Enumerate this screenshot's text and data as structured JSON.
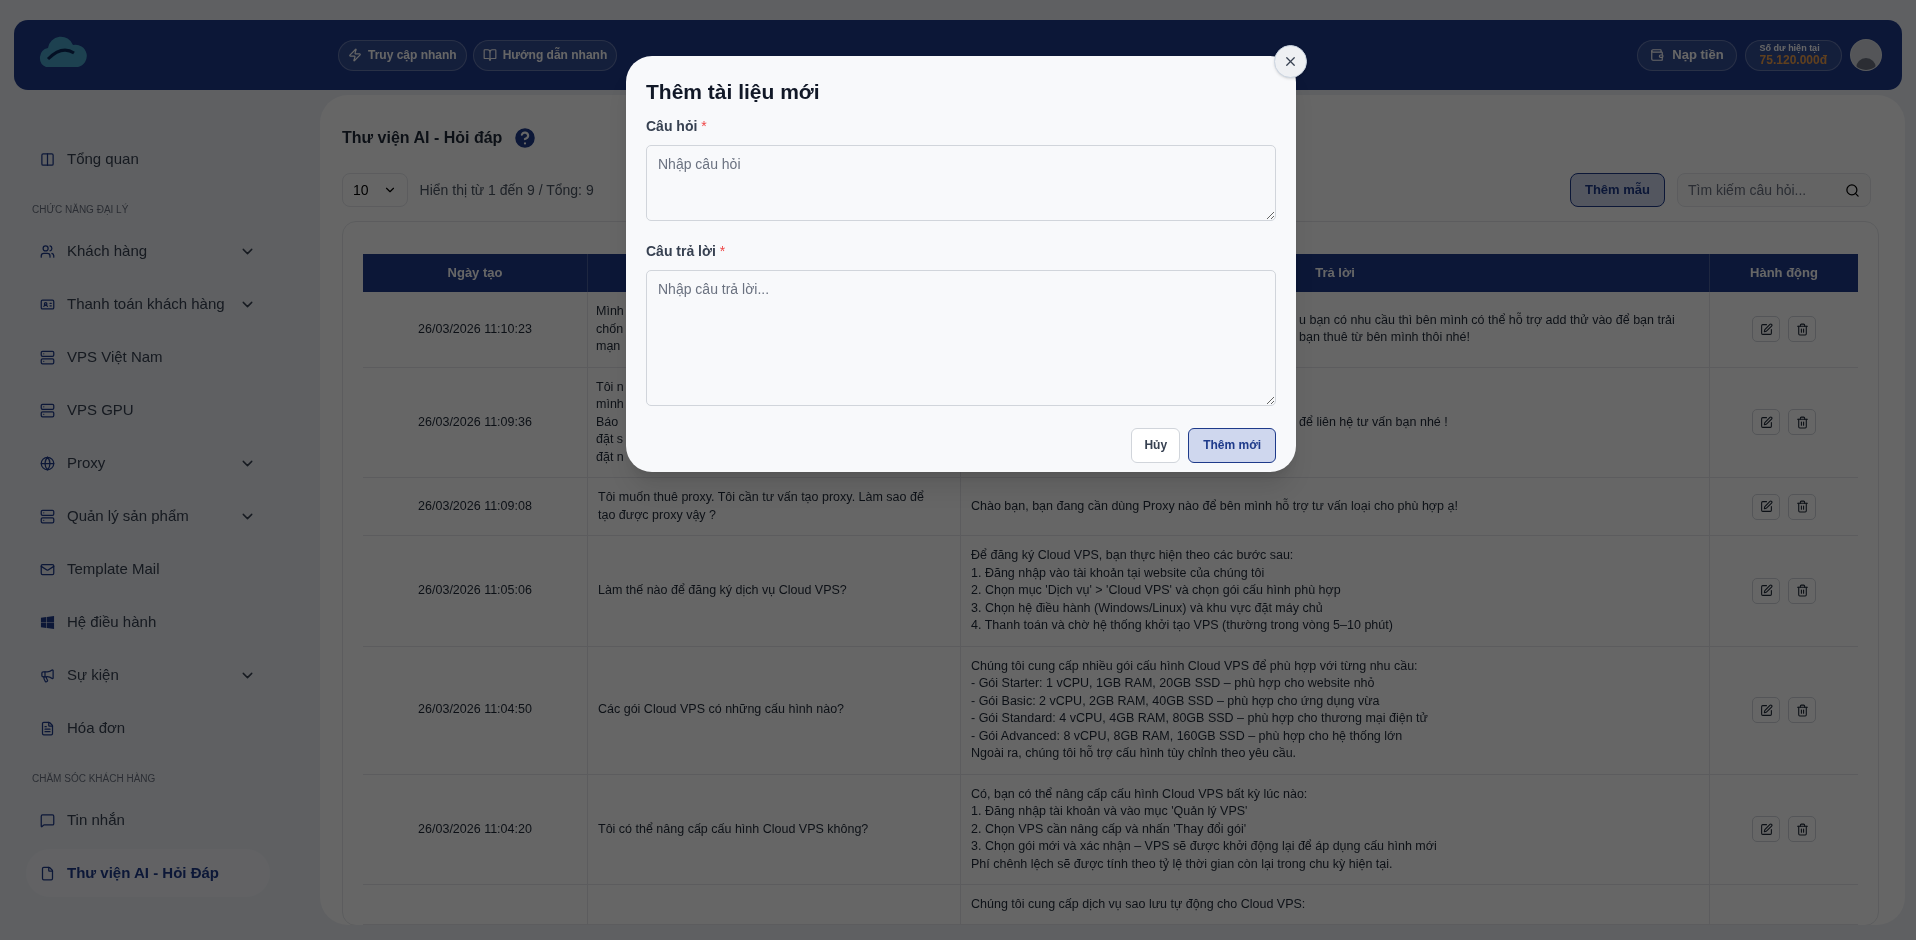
{
  "header": {
    "quick_links": [
      "Truy cập nhanh",
      "Hướng dẫn nhanh"
    ],
    "topup": "Nạp tiền",
    "balance": {
      "label": "Số dư hiện tại",
      "value": "75.120.000đ"
    }
  },
  "sidebar": {
    "sections": [
      {
        "items": [
          {
            "label": "Tổng quan",
            "expandable": false,
            "selected": false
          }
        ]
      },
      {
        "label": "CHỨC NĂNG ĐẠI LÝ",
        "items": [
          {
            "label": "Khách hàng",
            "expandable": true,
            "selected": false
          },
          {
            "label": "Thanh toán khách hàng",
            "expandable": true,
            "selected": false
          },
          {
            "label": "VPS Việt Nam",
            "expandable": false,
            "selected": false
          },
          {
            "label": "VPS GPU",
            "expandable": false,
            "selected": false
          },
          {
            "label": "Proxy",
            "expandable": true,
            "selected": false
          },
          {
            "label": "Quản lý sản phẩm",
            "expandable": true,
            "selected": false
          },
          {
            "label": "Template Mail",
            "expandable": false,
            "selected": false
          },
          {
            "label": "Hệ điều hành",
            "expandable": false,
            "selected": false
          },
          {
            "label": "Sự kiện",
            "expandable": true,
            "selected": false
          },
          {
            "label": "Hóa đơn",
            "expandable": false,
            "selected": false
          }
        ]
      },
      {
        "label": "CHĂM SÓC KHÁCH HÀNG",
        "items": [
          {
            "label": "Tin nhắn",
            "expandable": false,
            "selected": false
          },
          {
            "label": "Thư viện AI - Hỏi Đáp",
            "expandable": false,
            "selected": true
          }
        ]
      }
    ]
  },
  "page": {
    "title": "Thư viện AI - Hỏi đáp",
    "page_size": "10",
    "summary": "Hiển thị từ 1 đến 9 / Tổng: 9",
    "add_template": "Thêm mẫu",
    "search": {
      "placeholder": "Tìm kiếm câu hỏi..."
    }
  },
  "table": {
    "columns": {
      "date": "Ngày tạo",
      "answer": "Trả lời",
      "actions": "Hành động"
    },
    "rows": [
      {
        "date": "26/03/2026 11:10:23",
        "question": {
          "kind": "clipped",
          "text": "Mình\nchốn\nmạn"
        },
        "answer": {
          "kind": "clipped",
          "text": "u bạn có nhu cầu thì bên mình có thể hỗ trợ add thử vào để bạn trải\nbạn thuê từ bên mình thôi nhé!"
        }
      },
      {
        "date": "26/03/2026 11:09:36",
        "question": {
          "kind": "clipped",
          "text": "Tôi n\nmình\nBáo\nđặt s\nđặt n"
        },
        "answer": {
          "kind": "clipped",
          "text": "để liên hệ tư vấn bạn nhé !"
        }
      },
      {
        "date": "26/03/2026 11:09:08",
        "question": {
          "kind": "full",
          "text": "Tôi muốn thuê proxy. Tôi cần tư vấn tạo proxy. Làm sao để\ntạo được proxy vậy ?"
        },
        "answer": {
          "kind": "full",
          "text": "Chào bạn, bạn đang cần dùng Proxy nào để bên mình hỗ trợ tư vấn loại cho phù hợp ạ!"
        }
      },
      {
        "date": "26/03/2026 11:05:06",
        "question": {
          "kind": "full",
          "text": "Làm thế nào để đăng ký dịch vụ Cloud VPS?"
        },
        "answer": {
          "kind": "full",
          "text": "Để đăng ký Cloud VPS, bạn thực hiện theo các bước sau:\n1. Đăng nhập vào tài khoản tại website của chúng tôi\n2. Chọn mục 'Dịch vụ' > 'Cloud VPS' và chọn gói cấu hình phù hợp\n3. Chọn hệ điều hành (Windows/Linux) và khu vực đặt máy chủ\n4. Thanh toán và chờ hệ thống khởi tạo VPS (thường trong vòng 5–10 phút)"
        }
      },
      {
        "date": "26/03/2026 11:04:50",
        "question": {
          "kind": "full",
          "text": "Các gói Cloud VPS có những cấu hình nào?"
        },
        "answer": {
          "kind": "full",
          "text": "Chúng tôi cung cấp nhiều gói cấu hình Cloud VPS để phù hợp với từng nhu cầu:\n- Gói Starter: 1 vCPU, 1GB RAM, 20GB SSD – phù hợp cho website nhỏ\n- Gói Basic: 2 vCPU, 2GB RAM, 40GB SSD – phù hợp cho ứng dụng vừa\n- Gói Standard: 4 vCPU, 4GB RAM, 80GB SSD – phù hợp cho thương mại điện tử\n- Gói Advanced: 8 vCPU, 8GB RAM, 160GB SSD – phù hợp cho hệ thống lớn\nNgoài ra, chúng tôi hỗ trợ cấu hình tùy chỉnh theo yêu cầu."
        }
      },
      {
        "date": "26/03/2026 11:04:20",
        "question": {
          "kind": "full",
          "text": "Tôi có thể nâng cấp cấu hình Cloud VPS không?"
        },
        "answer": {
          "kind": "full",
          "text": "Có, bạn có thể nâng cấp cấu hình Cloud VPS bất kỳ lúc nào:\n1. Đăng nhập tài khoản và vào mục 'Quản lý VPS'\n2. Chọn VPS cần nâng cấp và nhấn 'Thay đổi gói'\n3. Chọn gói mới và xác nhận – VPS sẽ được khởi động lại để áp dụng cấu hình mới\nPhí chênh lệch sẽ được tính theo tỷ lệ thời gian còn lại trong chu kỳ hiện tại."
        }
      },
      {
        "answer": {
          "kind": "full",
          "text": "Chúng tôi cung cấp dịch vụ sao lưu tự động cho Cloud VPS:"
        }
      }
    ]
  },
  "modal": {
    "title": "Thêm tài liệu mới",
    "fields": [
      {
        "label": "Câu hỏi",
        "required_mark": "*",
        "placeholder": "Nhập câu hỏi",
        "kind": "short"
      },
      {
        "label": "Câu trả lời",
        "required_mark": "*",
        "placeholder": "Nhập câu trả lời...",
        "kind": "tall"
      }
    ],
    "cancel": "Hủy",
    "submit": "Thêm mới"
  }
}
